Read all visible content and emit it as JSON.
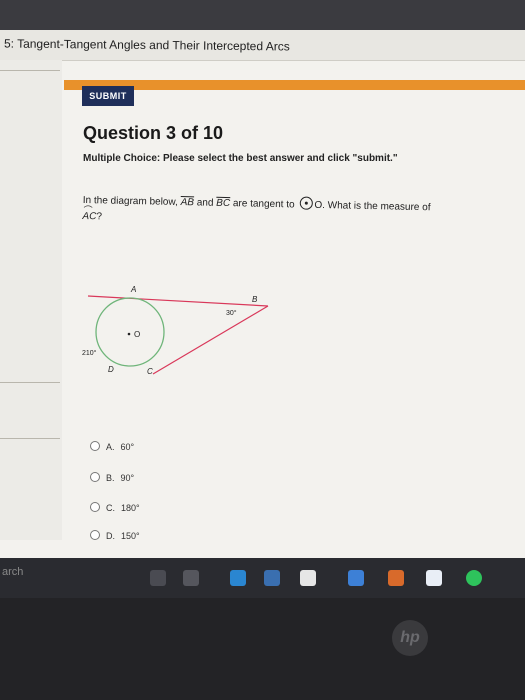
{
  "window": {
    "title": "5: Tangent-Tangent Angles and Their Intercepted Arcs"
  },
  "toolbar": {
    "submit_label": "SUBMIT"
  },
  "question": {
    "title": "Question 3 of 10",
    "instruction": "Multiple Choice: Please select the best answer and click \"submit.\"",
    "text_part1": "In the diagram below,",
    "seg1": "AB",
    "and": "and",
    "seg2": "BC",
    "text_part2": "are tangent to",
    "circle_label": "O.",
    "text_part3": "What is the measure of",
    "arc_label": "AC",
    "question_mark": "?"
  },
  "diagram": {
    "point_a": "A",
    "point_b": "B",
    "point_c": "C",
    "point_d": "D",
    "center": "O",
    "angle_b": "30°",
    "arc_adc": "210°"
  },
  "options": [
    {
      "letter": "A.",
      "value": "60°"
    },
    {
      "letter": "B.",
      "value": "90°"
    },
    {
      "letter": "C.",
      "value": "180°"
    },
    {
      "letter": "D.",
      "value": "150°"
    }
  ],
  "taskbar": {
    "search_text": "arch"
  },
  "colors": {
    "accent": "#e8912b",
    "submit_bg": "#1f2f5a",
    "tangent_line": "#d9385a",
    "circle": "#6fb57a"
  },
  "device": {
    "brand": "hp"
  }
}
